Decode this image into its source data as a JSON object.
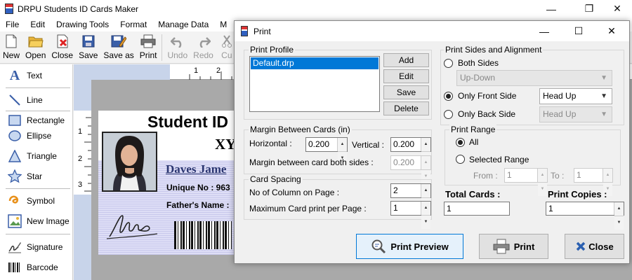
{
  "app": {
    "title": "DRPU Students ID Cards Maker",
    "controls": {
      "minimize": "—",
      "restore": "❐",
      "close": "✕"
    }
  },
  "menu": [
    "File",
    "Edit",
    "Drawing Tools",
    "Format",
    "Manage Data",
    "M"
  ],
  "toolbar": {
    "new": "New",
    "open": "Open",
    "close": "Close",
    "save": "Save",
    "save_as": "Save as",
    "print": "Print",
    "undo": "Undo",
    "redo": "Redo",
    "cut": "Cu"
  },
  "tools": {
    "text": "Text",
    "line": "Line",
    "rectangle": "Rectangle",
    "ellipse": "Ellipse",
    "triangle": "Triangle",
    "star": "Star",
    "symbol": "Symbol",
    "new_image": "New Image",
    "signature": "Signature",
    "barcode": "Barcode"
  },
  "rulers": {
    "top": [
      "1",
      "2"
    ],
    "left": [
      "1",
      "2",
      "3"
    ]
  },
  "card": {
    "title": "Student ID",
    "school": "XY",
    "name": "Daves Jame",
    "unique_label": "Unique No :  963",
    "father_label": "Father's Name :"
  },
  "dialog": {
    "title": "Print",
    "controls": {
      "minimize": "—",
      "maximize": "☐",
      "close": "✕"
    },
    "print_profile": {
      "label": "Print Profile",
      "items": [
        "Default.drp"
      ],
      "add": "Add",
      "edit": "Edit",
      "save": "Save",
      "delete": "Delete"
    },
    "margin": {
      "label": "Margin Between Cards (in)",
      "horizontal_label": "Horizontal :",
      "horizontal_value": "0.200",
      "vertical_label": "Vertical :",
      "vertical_value": "0.200",
      "both_sides_label": "Margin between card both sides :",
      "both_sides_value": "0.200"
    },
    "card_spacing": {
      "label": "Card Spacing",
      "columns_label": "No of Column on Page :",
      "columns_value": "2",
      "max_label": "Maximum Card print per Page :",
      "max_value": "1"
    },
    "sides": {
      "label": "Print Sides and Alignment",
      "both_sides": "Both Sides",
      "both_sides_combo": "Up-Down",
      "only_front": "Only Front Side",
      "front_combo": "Head Up",
      "only_back": "Only Back Side",
      "back_combo": "Head Up"
    },
    "range": {
      "label": "Print Range",
      "all": "All",
      "selected": "Selected Range",
      "from_label": "From :",
      "from_value": "1",
      "to_label": "To :",
      "to_value": "1"
    },
    "total_cards": {
      "label": "Total Cards :",
      "value": "1"
    },
    "print_copies": {
      "label": "Print Copies :",
      "value": "1"
    },
    "buttons": {
      "preview": "Print Preview",
      "print": "Print",
      "close": "Close"
    }
  },
  "colors": {
    "selection": "#0078d7",
    "focus": "#0078d7",
    "card_name": "#2a3570"
  }
}
